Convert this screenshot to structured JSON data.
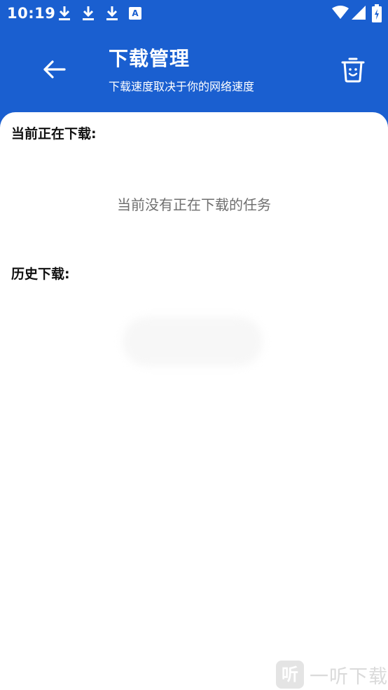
{
  "status_bar": {
    "time": "10:19",
    "a_badge": "A",
    "icons": [
      "download-icon",
      "download-icon",
      "download-icon",
      "a-badge-icon",
      "wifi-icon",
      "signal-icon",
      "battery-icon"
    ]
  },
  "header": {
    "title": "下载管理",
    "subtitle": "下载速度取决于你的网络速度",
    "back_icon": "arrow-left-icon",
    "trash_icon": "trash-icon"
  },
  "content": {
    "current_label": "当前正在下载:",
    "empty_message": "当前没有正在下载的任务",
    "history_label": "历史下载:"
  },
  "watermark": {
    "logo_text": "听",
    "text": "一听下载"
  },
  "colors": {
    "primary": "#1a5fd0",
    "background": "#ffffff",
    "empty_text": "#6f6f6f"
  }
}
